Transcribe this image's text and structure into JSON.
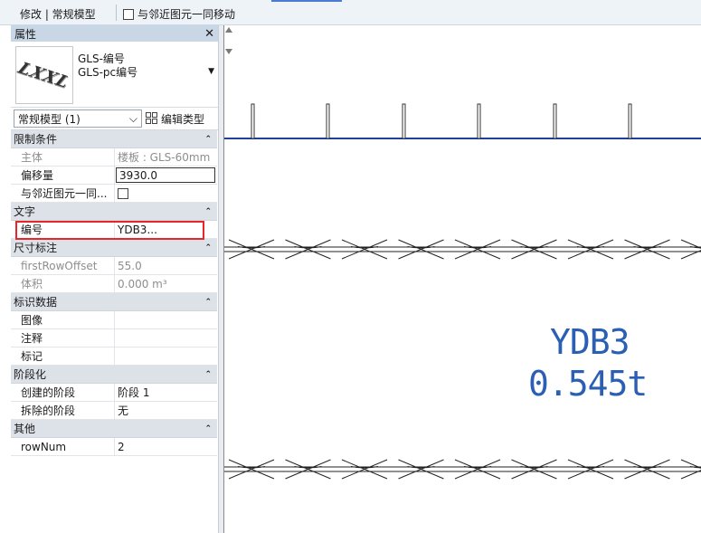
{
  "toolbar": {
    "mode_label": "修改 | 常规模型",
    "move_with_nearby_label": "与邻近图元一同移动",
    "move_with_nearby_checked": false
  },
  "properties": {
    "title": "属性",
    "close_icon": "close-icon",
    "type_selector": {
      "family": "GLS-编号",
      "type": "GLS-pc编号",
      "thumbnail_text": "LXXL"
    },
    "filter": {
      "value": "常规模型 (1)",
      "edit_type_label": "编辑类型"
    },
    "groups": [
      {
        "name": "限制条件",
        "rows": [
          {
            "key": "主体",
            "value": "楼板 : GLS-60mm",
            "readonly": true
          },
          {
            "key": "偏移量",
            "value": "3930.0",
            "editing": true
          },
          {
            "key": "与邻近图元一同...",
            "value": "",
            "checkbox": true
          }
        ]
      },
      {
        "name": "文字",
        "rows": [
          {
            "key": "编号",
            "value": "YDB3..."
          }
        ]
      },
      {
        "name": "尺寸标注",
        "rows": [
          {
            "key": "firstRowOffset",
            "value": "55.0",
            "readonly": true
          },
          {
            "key": "体积",
            "value": "0.000 m³",
            "readonly": true
          }
        ]
      },
      {
        "name": "标识数据",
        "rows": [
          {
            "key": "图像",
            "value": ""
          },
          {
            "key": "注释",
            "value": ""
          },
          {
            "key": "标记",
            "value": ""
          }
        ]
      },
      {
        "name": "阶段化",
        "rows": [
          {
            "key": "创建的阶段",
            "value": "阶段 1"
          },
          {
            "key": "拆除的阶段",
            "value": "无"
          }
        ]
      },
      {
        "name": "其他",
        "rows": [
          {
            "key": "rowNum",
            "value": "2"
          }
        ]
      }
    ]
  },
  "canvas": {
    "tag_code": "YDB3",
    "tag_weight": "0.545t",
    "line_color": "#1f3f9a",
    "tag_color": "#2a5fb5"
  }
}
